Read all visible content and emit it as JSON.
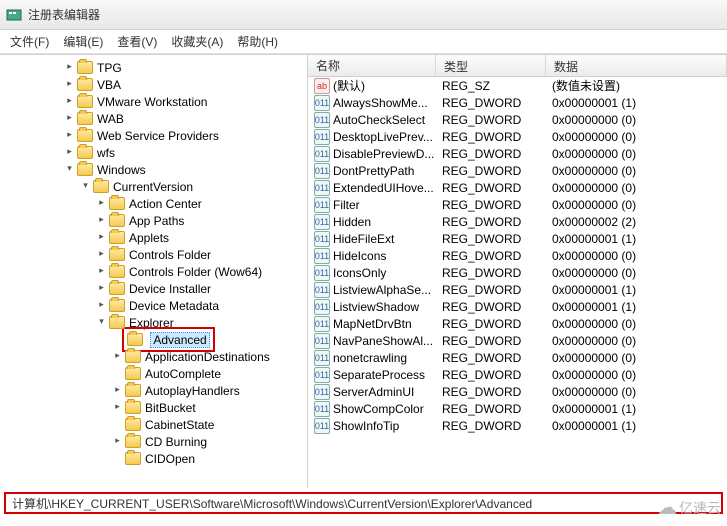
{
  "window": {
    "title": "注册表编辑器"
  },
  "menu": {
    "file": "文件(F)",
    "edit": "编辑(E)",
    "view": "查看(V)",
    "favorites": "收藏夹(A)",
    "help": "帮助(H)"
  },
  "tree": {
    "nodes": [
      {
        "label": "TPG",
        "depth": 4,
        "state": "closed"
      },
      {
        "label": "VBA",
        "depth": 4,
        "state": "closed"
      },
      {
        "label": "VMware Workstation",
        "depth": 4,
        "state": "closed"
      },
      {
        "label": "WAB",
        "depth": 4,
        "state": "closed"
      },
      {
        "label": "Web Service Providers",
        "depth": 4,
        "state": "closed"
      },
      {
        "label": "wfs",
        "depth": 4,
        "state": "closed"
      },
      {
        "label": "Windows",
        "depth": 4,
        "state": "open"
      },
      {
        "label": "CurrentVersion",
        "depth": 5,
        "state": "open"
      },
      {
        "label": "Action Center",
        "depth": 6,
        "state": "closed"
      },
      {
        "label": "App Paths",
        "depth": 6,
        "state": "closed"
      },
      {
        "label": "Applets",
        "depth": 6,
        "state": "closed"
      },
      {
        "label": "Controls Folder",
        "depth": 6,
        "state": "closed"
      },
      {
        "label": "Controls Folder (Wow64)",
        "depth": 6,
        "state": "closed"
      },
      {
        "label": "Device Installer",
        "depth": 6,
        "state": "closed"
      },
      {
        "label": "Device Metadata",
        "depth": 6,
        "state": "closed"
      },
      {
        "label": "Explorer",
        "depth": 6,
        "state": "open"
      },
      {
        "label": "Advanced",
        "depth": 7,
        "state": "none",
        "selected": true,
        "highlight": true
      },
      {
        "label": "ApplicationDestinations",
        "depth": 7,
        "state": "closed"
      },
      {
        "label": "AutoComplete",
        "depth": 7,
        "state": "none"
      },
      {
        "label": "AutoplayHandlers",
        "depth": 7,
        "state": "closed"
      },
      {
        "label": "BitBucket",
        "depth": 7,
        "state": "closed"
      },
      {
        "label": "CabinetState",
        "depth": 7,
        "state": "none"
      },
      {
        "label": "CD Burning",
        "depth": 7,
        "state": "closed"
      },
      {
        "label": "CIDOpen",
        "depth": 7,
        "state": "none"
      }
    ]
  },
  "columns": {
    "name": "名称",
    "type": "类型",
    "data": "数据"
  },
  "values": [
    {
      "icon": "str",
      "name": "(默认)",
      "type": "REG_SZ",
      "data": "(数值未设置)"
    },
    {
      "icon": "bin",
      "name": "AlwaysShowMe...",
      "type": "REG_DWORD",
      "data": "0x00000001 (1)"
    },
    {
      "icon": "bin",
      "name": "AutoCheckSelect",
      "type": "REG_DWORD",
      "data": "0x00000000 (0)"
    },
    {
      "icon": "bin",
      "name": "DesktopLivePrev...",
      "type": "REG_DWORD",
      "data": "0x00000000 (0)"
    },
    {
      "icon": "bin",
      "name": "DisablePreviewD...",
      "type": "REG_DWORD",
      "data": "0x00000000 (0)"
    },
    {
      "icon": "bin",
      "name": "DontPrettyPath",
      "type": "REG_DWORD",
      "data": "0x00000000 (0)"
    },
    {
      "icon": "bin",
      "name": "ExtendedUIHove...",
      "type": "REG_DWORD",
      "data": "0x00000000 (0)"
    },
    {
      "icon": "bin",
      "name": "Filter",
      "type": "REG_DWORD",
      "data": "0x00000000 (0)"
    },
    {
      "icon": "bin",
      "name": "Hidden",
      "type": "REG_DWORD",
      "data": "0x00000002 (2)"
    },
    {
      "icon": "bin",
      "name": "HideFileExt",
      "type": "REG_DWORD",
      "data": "0x00000001 (1)"
    },
    {
      "icon": "bin",
      "name": "HideIcons",
      "type": "REG_DWORD",
      "data": "0x00000000 (0)"
    },
    {
      "icon": "bin",
      "name": "IconsOnly",
      "type": "REG_DWORD",
      "data": "0x00000000 (0)"
    },
    {
      "icon": "bin",
      "name": "ListviewAlphaSe...",
      "type": "REG_DWORD",
      "data": "0x00000001 (1)"
    },
    {
      "icon": "bin",
      "name": "ListviewShadow",
      "type": "REG_DWORD",
      "data": "0x00000001 (1)"
    },
    {
      "icon": "bin",
      "name": "MapNetDrvBtn",
      "type": "REG_DWORD",
      "data": "0x00000000 (0)"
    },
    {
      "icon": "bin",
      "name": "NavPaneShowAl...",
      "type": "REG_DWORD",
      "data": "0x00000000 (0)"
    },
    {
      "icon": "bin",
      "name": "nonetcrawling",
      "type": "REG_DWORD",
      "data": "0x00000000 (0)"
    },
    {
      "icon": "bin",
      "name": "SeparateProcess",
      "type": "REG_DWORD",
      "data": "0x00000000 (0)"
    },
    {
      "icon": "bin",
      "name": "ServerAdminUI",
      "type": "REG_DWORD",
      "data": "0x00000000 (0)"
    },
    {
      "icon": "bin",
      "name": "ShowCompColor",
      "type": "REG_DWORD",
      "data": "0x00000001 (1)"
    },
    {
      "icon": "bin",
      "name": "ShowInfoTip",
      "type": "REG_DWORD",
      "data": "0x00000001 (1)"
    }
  ],
  "status_path": "计算机\\HKEY_CURRENT_USER\\Software\\Microsoft\\Windows\\CurrentVersion\\Explorer\\Advanced",
  "watermark": "亿速云"
}
